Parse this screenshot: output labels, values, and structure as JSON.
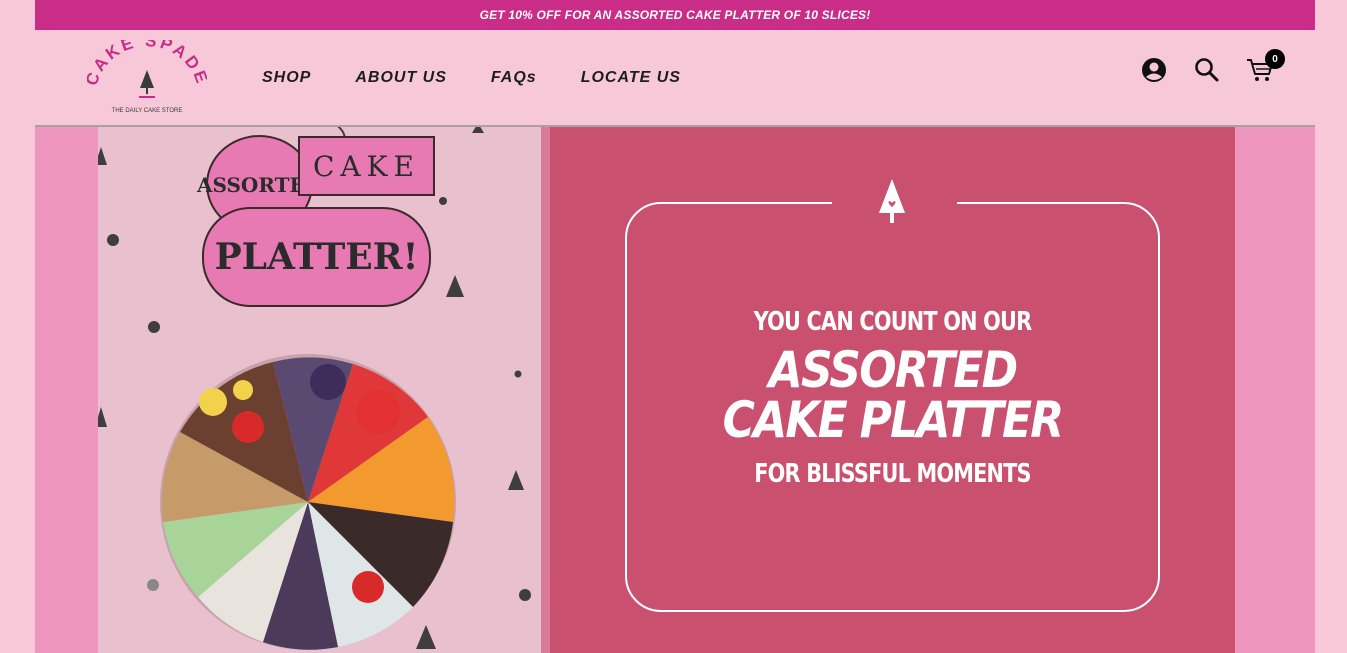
{
  "promo_bar": {
    "text": "GET 10% OFF FOR AN ASSORTED CAKE PLATTER OF 10 SLICES!"
  },
  "logo": {
    "brand": "CAKE SPADE",
    "tagline": "THE DAILY CAKE STORE"
  },
  "nav": {
    "items": [
      "SHOP",
      "ABOUT US",
      "FAQs",
      "LOCATE US"
    ]
  },
  "header": {
    "cart_count": "0"
  },
  "banner": {
    "photo_tags": {
      "tag1": "ASSORTED",
      "tag2": "CAKE",
      "tag3": "PLATTER!"
    },
    "line1": "YOU CAN COUNT ON OUR",
    "line2a": "ASSORTED",
    "line2b": "CAKE PLATTER",
    "line3": "FOR BLISSFUL MOMENTS"
  },
  "colors": {
    "accent": "#c92d87",
    "panel": "#c9506f",
    "header_bg": "#f7c9d8"
  },
  "icons": [
    "user-icon",
    "search-icon",
    "cart-icon",
    "spade-icon"
  ]
}
